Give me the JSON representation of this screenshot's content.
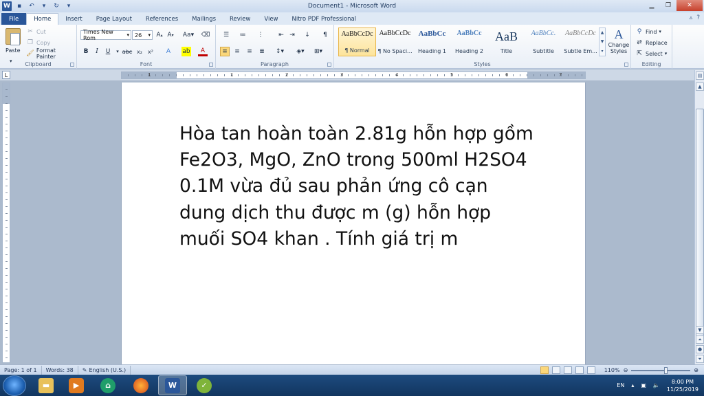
{
  "window": {
    "title": "Document1 - Microsoft Word"
  },
  "tabs": [
    {
      "label": "File"
    },
    {
      "label": "Home"
    },
    {
      "label": "Insert"
    },
    {
      "label": "Page Layout"
    },
    {
      "label": "References"
    },
    {
      "label": "Mailings"
    },
    {
      "label": "Review"
    },
    {
      "label": "View"
    },
    {
      "label": "Nitro PDF Professional"
    }
  ],
  "ribbon": {
    "clipboard": {
      "paste": "Paste",
      "cut": "Cut",
      "copy": "Copy",
      "format_painter": "Format Painter",
      "label": "Clipboard"
    },
    "font": {
      "name": "Times New Rom",
      "size": "26",
      "label": "Font"
    },
    "paragraph": {
      "label": "Paragraph"
    },
    "styles": {
      "items": [
        {
          "sample": "AaBbCcDc",
          "name": "¶ Normal"
        },
        {
          "sample": "AaBbCcDc",
          "name": "¶ No Spaci..."
        },
        {
          "sample": "AaBbCc",
          "name": "Heading 1"
        },
        {
          "sample": "AaBbCc",
          "name": "Heading 2"
        },
        {
          "sample": "AaB",
          "name": "Title"
        },
        {
          "sample": "AaBbCc.",
          "name": "Subtitle"
        },
        {
          "sample": "AaBbCcDc",
          "name": "Subtle Em..."
        }
      ],
      "change_styles_line1": "Change",
      "change_styles_line2": "Styles",
      "label": "Styles"
    },
    "editing": {
      "find": "Find",
      "replace": "Replace",
      "select": "Select",
      "label": "Editing"
    }
  },
  "ruler": {
    "numbers": [
      "1",
      "1",
      "2",
      "3",
      "4",
      "5",
      "6",
      "7"
    ]
  },
  "document": {
    "text": "Hòa tan hoàn toàn 2.81g hỗn hợp gồm Fe2O3, MgO, ZnO trong 500ml H2SO4 0.1M vừa đủ sau phản ứng cô cạn dung dịch thu được m (g) hỗn hợp muối SO4 khan . Tính giá trị m"
  },
  "status": {
    "page": "Page: 1 of 1",
    "words": "Words: 38",
    "language": "English (U.S.)",
    "zoom": "110%",
    "zoom_level": 1.1
  },
  "taskbar": {
    "lang": "EN",
    "time": "8:00 PM",
    "date": "11/25/2019"
  },
  "colors": {
    "file_tab": "#2a5699",
    "accent": "#2b579a"
  }
}
